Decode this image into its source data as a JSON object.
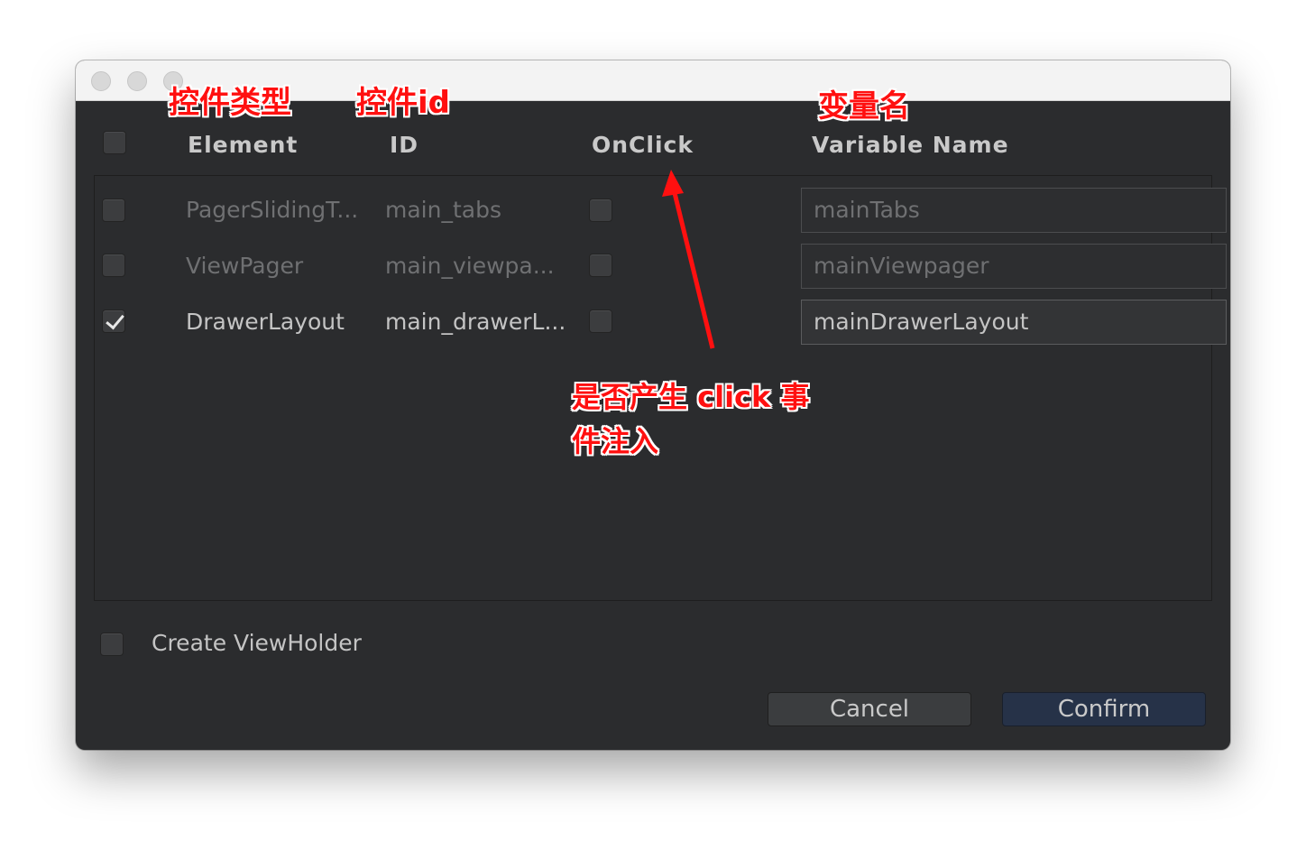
{
  "header": {
    "element": "Element",
    "id": "ID",
    "onclick": "OnClick",
    "variable_name": "Variable Name"
  },
  "rows": [
    {
      "element": "PagerSlidingT...",
      "id": "main_tabs",
      "variable": "mainTabs",
      "checked": false,
      "onclick": false,
      "active": false
    },
    {
      "element": "ViewPager",
      "id": "main_viewpa...",
      "variable": "mainViewpager",
      "checked": false,
      "onclick": false,
      "active": false
    },
    {
      "element": "DrawerLayout",
      "id": "main_drawerL...",
      "variable": "mainDrawerLayout",
      "checked": true,
      "onclick": false,
      "active": true
    }
  ],
  "footer": {
    "create_viewholder_label": "Create ViewHolder",
    "create_viewholder_checked": false,
    "cancel_label": "Cancel",
    "confirm_label": "Confirm"
  },
  "annotations": {
    "element_type": "控件类型",
    "control_id": "控件id",
    "variable_name": "变量名",
    "onclick_note_line1": "是否产生 click 事",
    "onclick_note_line2": "件注入"
  },
  "colors": {
    "annotation": "#ff1010",
    "window_bg": "#2b2c2e",
    "confirm_bg": "#263248"
  }
}
